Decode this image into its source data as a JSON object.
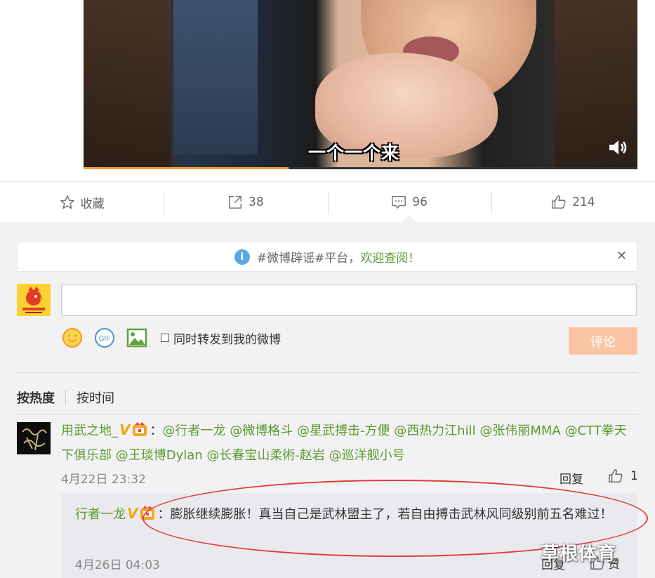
{
  "video": {
    "subtitle": "一个一个来",
    "progress_fraction": 0.37
  },
  "actions": {
    "favorite": {
      "label": "收藏",
      "icon": "star-icon"
    },
    "repost": {
      "count": "38",
      "icon": "share-icon"
    },
    "comment": {
      "count": "96",
      "icon": "comment-icon"
    },
    "like": {
      "count": "214",
      "icon": "thumbs-up-icon"
    }
  },
  "notice": {
    "prefix": "#微博辟谣#平台，",
    "link": "欢迎查阅！",
    "close": "✕"
  },
  "composer": {
    "repost_option": "同时转发到我的微博",
    "submit": "评论",
    "gif_label": "GIF"
  },
  "sort": {
    "hot": "按热度",
    "time": "按时间"
  },
  "comment": {
    "author": "用武之地_",
    "vip_mark": "V",
    "colon": "：",
    "mentions": [
      "@行者一龙",
      "@微博格斗",
      "@星武搏击-方便",
      "@西热力江hill",
      "@张伟丽MMA",
      "@CTT拳天下俱乐部",
      "@王琰博Dylan",
      "@长春宝山柔術-赵岩",
      "@巡洋舰小号"
    ],
    "time": "4月22日 23:32",
    "reply": "回复",
    "likes": "1"
  },
  "reply": {
    "author": "行者一龙",
    "vip_mark": "V",
    "text": "：膨胀继续膨胀！真当自己是武林盟主了，若自由搏击武林风同级别前五名难过！",
    "time": "4月26日 04:03",
    "reply": "回复",
    "like_label": "赞"
  },
  "watermark": "草根体育",
  "colors": {
    "accent_green": "#5b9b2b",
    "submit_bg": "#fbc5a4",
    "highlight_red": "#e23a3a",
    "progress": "#f7a035"
  }
}
